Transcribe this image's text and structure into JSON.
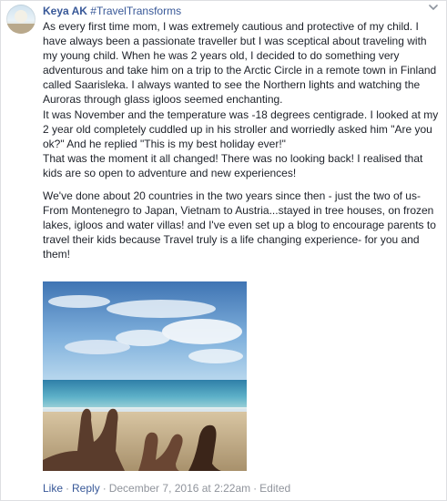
{
  "comment": {
    "author": "Keya AK",
    "hashtag": "#TravelTransforms",
    "paragraph1_lines": [
      "As every first time mom, I was extremely cautious and protective of my child. I have always been a passionate traveller but I was sceptical about traveling with my young child. When he was 2 years old, I decided to do something very adventurous and take him on a trip to the Arctic Circle in a remote town in Finland called Saarisleka. I always wanted to see the Northern lights and watching the Auroras through glass igloos seemed enchanting.",
      "It was November and the temperature was -18 degrees centigrade. I looked at my 2 year old completely cuddled up in his stroller and worriedly asked him \"Are you ok?\" And he replied \"This is my best holiday ever!\"",
      "That was the moment it all changed! There was no looking back! I realised that kids are so open to adventure and new experiences!"
    ],
    "paragraph2": "We've done about 20 countries in the two years since then - just the two of us-From Montenegro to Japan, Vietnam to Austria...stayed in tree houses, on frozen lakes, igloos and water villas! and I've even set up a blog to encourage parents to travel their kids because Travel truly is a life changing experience- for you and them!"
  },
  "footer": {
    "like_label": "Like",
    "reply_label": "Reply",
    "separator": "·",
    "timestamp": "December 7, 2016 at 2:22am",
    "edited_label": "Edited"
  },
  "icons": {
    "options": "chevron-down-icon",
    "avatar": "profile-photo",
    "photo": "beach-feet-photo"
  },
  "colors": {
    "link": "#385898",
    "text": "#1d2129",
    "meta": "#90949c",
    "border": "#dddfe2"
  }
}
